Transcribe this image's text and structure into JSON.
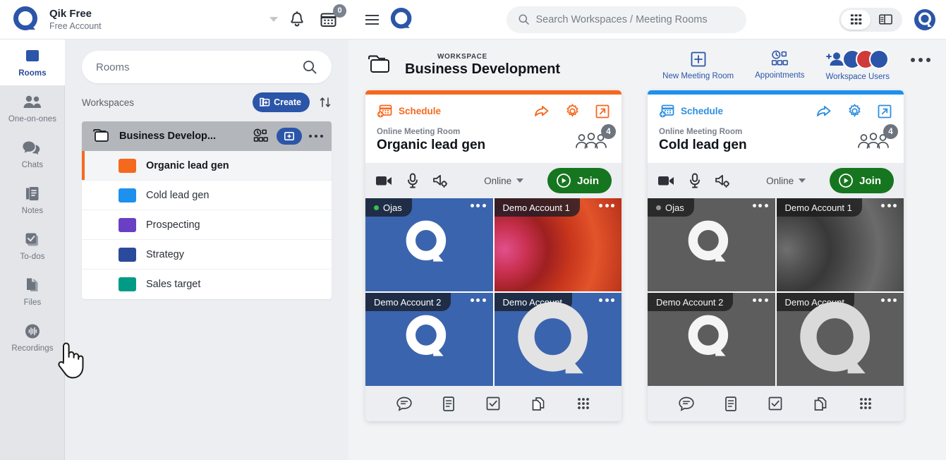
{
  "account": {
    "name": "Qik Free",
    "subtitle": "Free Account",
    "calendar_badge": "0",
    "bell_icon": "bell-icon",
    "calendar_icon": "calendar-icon",
    "caret_icon": "chevron-down-icon"
  },
  "rail": {
    "items": [
      {
        "label": "Rooms",
        "icon": "rooms-icon",
        "active": true
      },
      {
        "label": "One-on-ones",
        "icon": "people-icon",
        "active": false
      },
      {
        "label": "Chats",
        "icon": "chat-bubble-icon",
        "active": false
      },
      {
        "label": "Notes",
        "icon": "notes-icon",
        "active": false
      },
      {
        "label": "To-dos",
        "icon": "checkbox-icon",
        "active": false
      },
      {
        "label": "Files",
        "icon": "files-icon",
        "active": false
      },
      {
        "label": "Recordings",
        "icon": "recordings-icon",
        "active": false
      }
    ]
  },
  "rooms_panel": {
    "search_placeholder": "Rooms",
    "search_value": "",
    "search_icon": "search-icon",
    "workspaces_label": "Workspaces",
    "create_label": "Create",
    "create_icon": "create-icon",
    "sort_icon": "sort-icon",
    "workspace": {
      "name": "Business Develop...",
      "folder_icon": "folder-icon",
      "appointments_icon": "appointments-icon",
      "add_icon": "plus-icon",
      "more_icon": "more-icon"
    },
    "rooms": [
      {
        "name": "Organic lead gen",
        "color": "#f5691e",
        "selected": true
      },
      {
        "name": "Cold lead gen",
        "color": "#1e90ee",
        "selected": false
      },
      {
        "name": "Prospecting",
        "color": "#6b3fc4",
        "selected": false
      },
      {
        "name": "Strategy",
        "color": "#2b4a9b",
        "selected": false
      },
      {
        "name": "Sales target",
        "color": "#009b87",
        "selected": false
      }
    ]
  },
  "topbar": {
    "menu_icon": "hamburger-menu-icon",
    "logo_icon": "qik-logo-icon",
    "search_placeholder": "Search Workspaces / Meeting Rooms",
    "search_value": "",
    "search_icon": "search-icon",
    "grid_view_icon": "grid-view-icon",
    "panel_view_icon": "panel-view-icon",
    "grid_view_active": true,
    "avatar_icon": "user-avatar-icon"
  },
  "workspace_header": {
    "kicker": "WORKSPACE",
    "title": "Business Development",
    "folder_icon": "folder-icon",
    "actions": [
      {
        "label": "New Meeting Room",
        "icon": "plus-box-icon"
      },
      {
        "label": "Appointments",
        "icon": "appointments-icon"
      },
      {
        "label": "Workspace Users",
        "icon": "workspace-users-icon"
      }
    ],
    "more_icon": "more-icon"
  },
  "cards": [
    {
      "accent_color": "#f5691e",
      "schedule_label": "Schedule",
      "schedule_icon": "schedule-add-icon",
      "share_icon": "share-icon",
      "settings_icon": "gear-icon",
      "expand_icon": "open-external-icon",
      "kicker": "Online Meeting Room",
      "title": "Organic lead gen",
      "people_icon": "people-group-icon",
      "people_count": "4",
      "camera_icon": "camera-icon",
      "mic_icon": "microphone-icon",
      "speaker_icon": "speaker-settings-icon",
      "status": "Online",
      "join_label": "Join",
      "join_icon": "play-icon",
      "grayed": false,
      "participants": [
        {
          "name": "Ojas",
          "online": true,
          "style": "solid-blue"
        },
        {
          "name": "Demo Account 1",
          "online": false,
          "style": "photo-red"
        },
        {
          "name": "Demo Account 2",
          "online": false,
          "style": "solid-blue"
        },
        {
          "name": "Demo Account",
          "online": false,
          "style": "big-q"
        }
      ],
      "footer_icons": [
        "chat-icon",
        "notes-icon",
        "todos-icon",
        "files-icon",
        "apps-grid-icon"
      ]
    },
    {
      "accent_color": "#1e90ee",
      "schedule_label": "Schedule",
      "schedule_icon": "schedule-add-icon",
      "share_icon": "share-icon",
      "settings_icon": "gear-icon",
      "expand_icon": "open-external-icon",
      "kicker": "Online Meeting Room",
      "title": "Cold lead gen",
      "people_icon": "people-group-icon",
      "people_count": "4",
      "camera_icon": "camera-icon",
      "mic_icon": "microphone-icon",
      "speaker_icon": "speaker-settings-icon",
      "status": "Online",
      "join_label": "Join",
      "join_icon": "play-icon",
      "grayed": true,
      "participants": [
        {
          "name": "Ojas",
          "online": true,
          "style": "solid-blue"
        },
        {
          "name": "Demo Account 1",
          "online": false,
          "style": "photo-red"
        },
        {
          "name": "Demo Account 2",
          "online": false,
          "style": "solid-blue"
        },
        {
          "name": "Demo Account",
          "online": false,
          "style": "big-q"
        }
      ],
      "footer_icons": [
        "chat-icon",
        "notes-icon",
        "todos-icon",
        "files-icon",
        "apps-grid-icon"
      ]
    }
  ],
  "cursor": {
    "icon": "pointing-hand-cursor"
  }
}
